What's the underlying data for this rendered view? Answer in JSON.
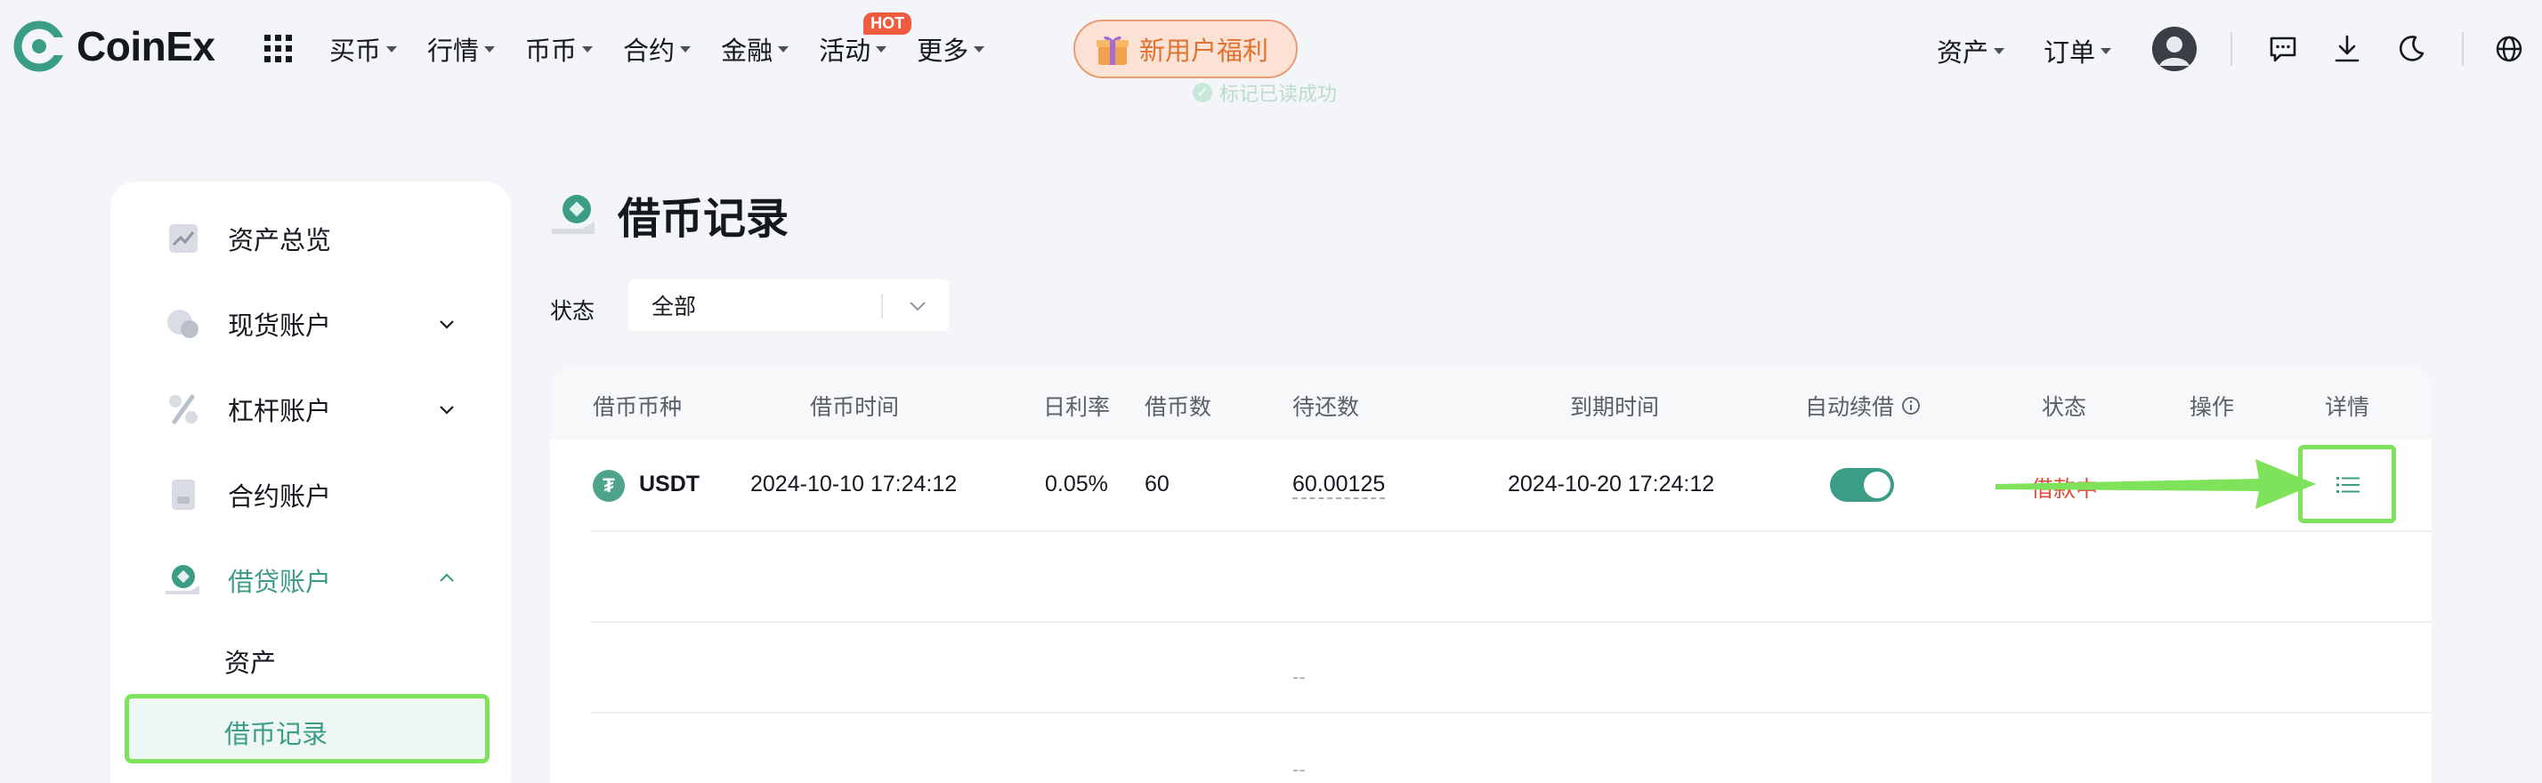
{
  "header": {
    "brand": "CoinEx",
    "nav": [
      "买币",
      "行情",
      "币币",
      "合约",
      "金融",
      "活动",
      "更多"
    ],
    "hot_badge": "HOT",
    "promo_label": "新用户福利",
    "toast": "标记已读成功",
    "assets_label": "资产",
    "orders_label": "订单"
  },
  "sidebar": {
    "items": [
      {
        "label": "资产总览",
        "icon": "chart-icon"
      },
      {
        "label": "现货账户",
        "icon": "coins-icon"
      },
      {
        "label": "杠杆账户",
        "icon": "percent-icon"
      },
      {
        "label": "合约账户",
        "icon": "document-icon"
      },
      {
        "label": "借贷账户",
        "icon": "loan-icon"
      }
    ],
    "sub_items": [
      "资产",
      "借币记录"
    ]
  },
  "page": {
    "title": "借币记录",
    "filter_label": "状态",
    "filter_value": "全部"
  },
  "table": {
    "columns": [
      "借币币种",
      "借币时间",
      "日利率",
      "借币数",
      "待还数",
      "到期时间",
      "自动续借",
      "状态",
      "操作",
      "详情"
    ],
    "rows": [
      {
        "coin": "USDT",
        "borrow_time": "2024-10-10 17:24:12",
        "daily_rate": "0.05%",
        "amount": "60",
        "to_repay": "60.00125",
        "expire_time": "2024-10-20 17:24:12",
        "auto_renew": true,
        "status": "借款中"
      }
    ],
    "empty_placeholder": "--"
  },
  "colors": {
    "accent": "#3b9d86",
    "highlight": "#7ee35b",
    "status_red": "#e24a3b",
    "promo": "#e0722f"
  }
}
